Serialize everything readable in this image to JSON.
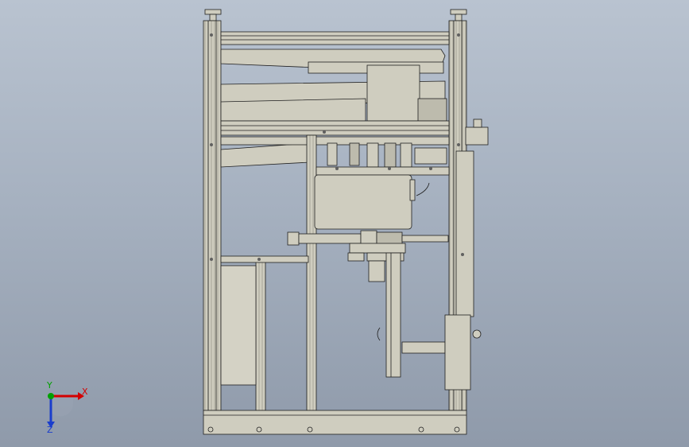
{
  "triad": {
    "x_label": "X",
    "y_label": "Y",
    "z_label": "Z",
    "x_color": "#d40000",
    "y_color": "#00a000",
    "z_color": "#1a3dcc"
  },
  "colors": {
    "part_fill": "#cfcdbf",
    "part_dark": "#b3b1a3",
    "edge": "#202020",
    "background_top": "#b9c3d0",
    "background_bottom": "#8f9aaa"
  }
}
